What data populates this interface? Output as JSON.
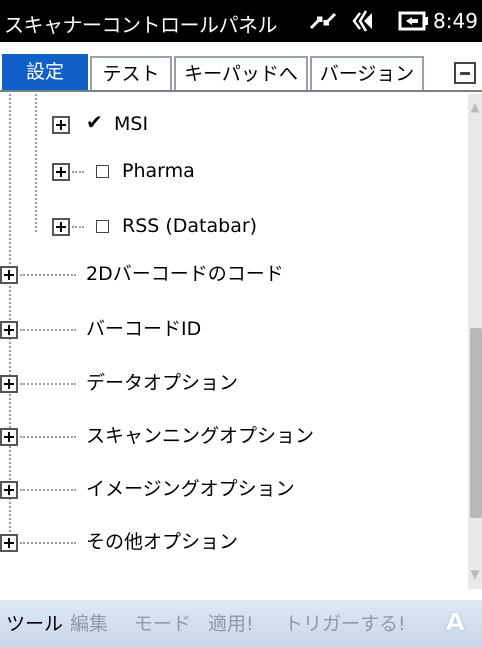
{
  "window": {
    "title": "スキャナーコントロールパネル",
    "time": "8:49",
    "icons": [
      "connection-icon",
      "volume-icon",
      "battery-icon"
    ]
  },
  "tabs": [
    {
      "label": "設定",
      "active": true
    },
    {
      "label": "テスト",
      "active": false
    },
    {
      "label": "キーパッドへ",
      "active": false
    },
    {
      "label": "バージョン",
      "active": false
    }
  ],
  "tree": {
    "child_items": [
      {
        "label": "MSI",
        "checked": true
      },
      {
        "label": "Pharma",
        "checked": false
      },
      {
        "label": "RSS (Databar)",
        "checked": false
      }
    ],
    "root_items": [
      {
        "label": "2Dバーコードのコード"
      },
      {
        "label": "バーコードID"
      },
      {
        "label": "データオプション"
      },
      {
        "label": "スキャンニングオプション"
      },
      {
        "label": "イメージングオプション"
      },
      {
        "label": "その他オプション"
      }
    ]
  },
  "menubar": {
    "items": [
      {
        "label": "ツール",
        "enabled": true
      },
      {
        "label": "編集",
        "enabled": false
      },
      {
        "label": "モード",
        "enabled": false
      },
      {
        "label": "適用!",
        "enabled": false
      },
      {
        "label": "トリガーする!",
        "enabled": false
      }
    ],
    "ime_label": "A"
  },
  "colors": {
    "active_tab": "#1060c8",
    "titlebar": "#000000",
    "menubar": "#c7d6ea"
  }
}
